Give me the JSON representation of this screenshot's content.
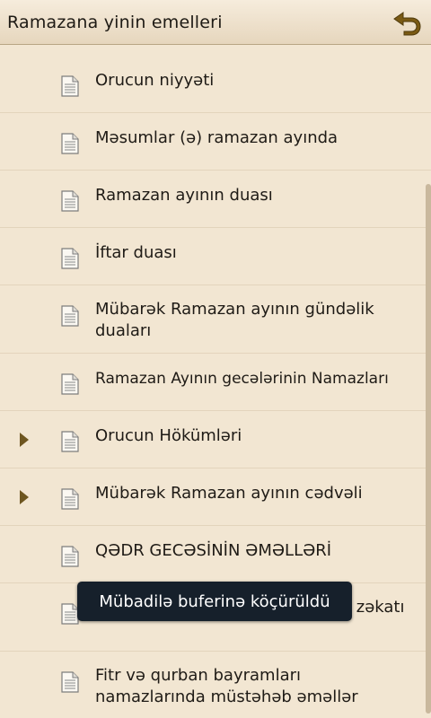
{
  "header": {
    "title": "Ramazana yinin emelleri",
    "back_icon": "back-arrow-icon"
  },
  "colors": {
    "background": "#f2e6d2",
    "accent": "#7a5a14",
    "toast_bg": "#16202b"
  },
  "items": [
    {
      "label": "Orucun niyyəti",
      "expandable": false
    },
    {
      "label": "Məsumlar (ə) ramazan ayında",
      "expandable": false
    },
    {
      "label": "Ramazan ayının duası",
      "expandable": false
    },
    {
      "label": "İftar duası",
      "expandable": false
    },
    {
      "label": "Mübarək Ramazan ayının gündəlik duaları",
      "expandable": false
    },
    {
      "label": "Ramazan Ayının gecələrinin Namazları",
      "expandable": false
    },
    {
      "label": "Orucun Hökümləri",
      "expandable": true
    },
    {
      "label": "Mübarək Ramazan ayının cədvəli",
      "expandable": true
    },
    {
      "label": "QƏDR GECƏSİNİN ƏMƏLLƏRİ",
      "expandable": false
    },
    {
      "label": "Fitr bayramının əməlləri və fitrə zəkatı",
      "expandable": false
    },
    {
      "label": "Fitr və qurban bayramları namazlarında müstəhəb əməllər",
      "expandable": false
    }
  ],
  "toast": {
    "text": "Mübadilə buferinə köçürüldü"
  }
}
